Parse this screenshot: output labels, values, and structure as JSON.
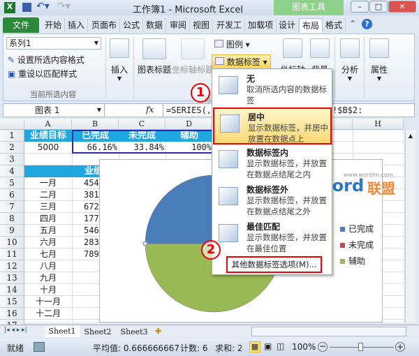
{
  "window": {
    "title": "工作簿1 - Microsoft Excel",
    "context_tab": "图表工具"
  },
  "tabs": [
    "文件",
    "开始",
    "插入",
    "页面布",
    "公式",
    "数据",
    "审阅",
    "视图",
    "开发工",
    "加载项",
    "设计",
    "布局",
    "格式"
  ],
  "active_tab": "布局",
  "ribbon": {
    "selection_box": "系列1",
    "format_selection": "设置所选内容格式",
    "reset_style": "重设以匹配样式",
    "group_current": "当前所选内容",
    "insert": "插入",
    "chart_title": "图表标题",
    "axis_title": "坐标轴标题",
    "legend": "图例",
    "data_labels": "数据标签",
    "group_labels_partial": "标签",
    "axes": "坐标轴",
    "background": "背景",
    "analysis": "分析",
    "properties": "属性"
  },
  "formula_bar": {
    "name_box": "图表 1",
    "fx": "fx",
    "formula": "=SERIES(,",
    "formula_tail": "!$B$2:"
  },
  "columns": [
    "A",
    "B",
    "C",
    "D",
    "H"
  ],
  "rows": [
    "1",
    "2",
    "3",
    "4",
    "5",
    "6",
    "7",
    "8",
    "9",
    "10",
    "11",
    "12",
    "13",
    "14",
    "15",
    "16",
    "17"
  ],
  "cells": {
    "row1": [
      "业绩目标",
      "已完成",
      "未完成",
      "辅助"
    ],
    "row2": [
      "5000",
      "66.16%",
      "33.84%",
      "100%"
    ],
    "row4_header": "业绩",
    "months": [
      "一月",
      "二月",
      "三月",
      "四月",
      "五月",
      "六月",
      "七月",
      "八月",
      "九月",
      "十月",
      "十一月",
      "十二月"
    ],
    "values_partial": [
      "454",
      "381",
      "672",
      "177",
      "546",
      "283",
      "789"
    ]
  },
  "chart_data": {
    "type": "pie",
    "categories": [
      "已完成",
      "未完成",
      "辅助"
    ],
    "values": [
      66.16,
      33.84,
      100
    ],
    "colors": [
      "#4a7ebb",
      "#be4b48",
      "#98b954"
    ],
    "legend": "right"
  },
  "menu": {
    "items": [
      {
        "title": "无",
        "desc": "取消所选内容的数据标签"
      },
      {
        "title": "居中",
        "desc": "显示数据标签，并居中放置在数据点上",
        "selected": true
      },
      {
        "title": "数据标签内",
        "desc": "显示数据标签，并放置在数据点结尾之内"
      },
      {
        "title": "数据标签外",
        "desc": "显示数据标签，并放置在数据点结尾之外"
      },
      {
        "title": "最佳匹配",
        "desc": "显示数据标签，并放置在最佳位置"
      }
    ],
    "more": "其他数据标签选项(M)..."
  },
  "annotations": [
    "1",
    "2"
  ],
  "watermark": {
    "url": "www.wordlm.com",
    "brand_a": "Word",
    "brand_b": "联盟"
  },
  "sheets": [
    "Sheet1",
    "Sheet2",
    "Sheet3"
  ],
  "status": {
    "ready": "就绪",
    "average": "平均值: 0.666666667",
    "count": "计数: 6",
    "sum": "求和: 2",
    "zoom": "100%"
  }
}
